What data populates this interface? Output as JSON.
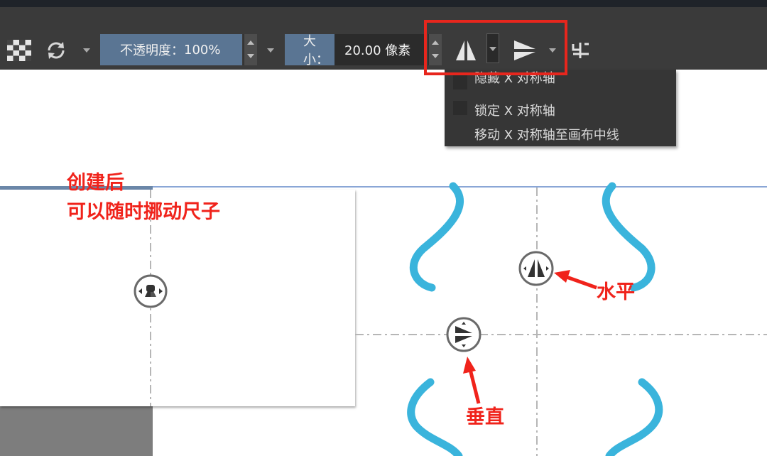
{
  "toolbar": {
    "opacity_label": "不透明度：",
    "opacity_value": "100%",
    "size_label": "大小：",
    "size_value": "20.00 像素"
  },
  "icons": {
    "pattern": "checker-pattern-icon",
    "reset": "refresh-icon",
    "mirror_horizontal": "mirror-horizontal-icon",
    "mirror_vertical": "mirror-vertical-icon",
    "wrap": "wrap-around-icon"
  },
  "mirror_menu": {
    "items": [
      {
        "label": "隐藏 X 对称轴",
        "checked": false
      },
      {
        "label": "锁定 X 对称轴",
        "checked": false
      },
      {
        "label": "移动 X 对称轴至画布中线",
        "checked": null
      }
    ]
  },
  "annotations": {
    "ruler_note_line1": "创建后",
    "ruler_note_line2": "可以随时挪动尺子",
    "horizontal": "水平",
    "vertical": "垂直"
  },
  "colors": {
    "highlight": "#e7261d",
    "stroke": "#3ab4dc",
    "accent_field": "#5a7593"
  }
}
